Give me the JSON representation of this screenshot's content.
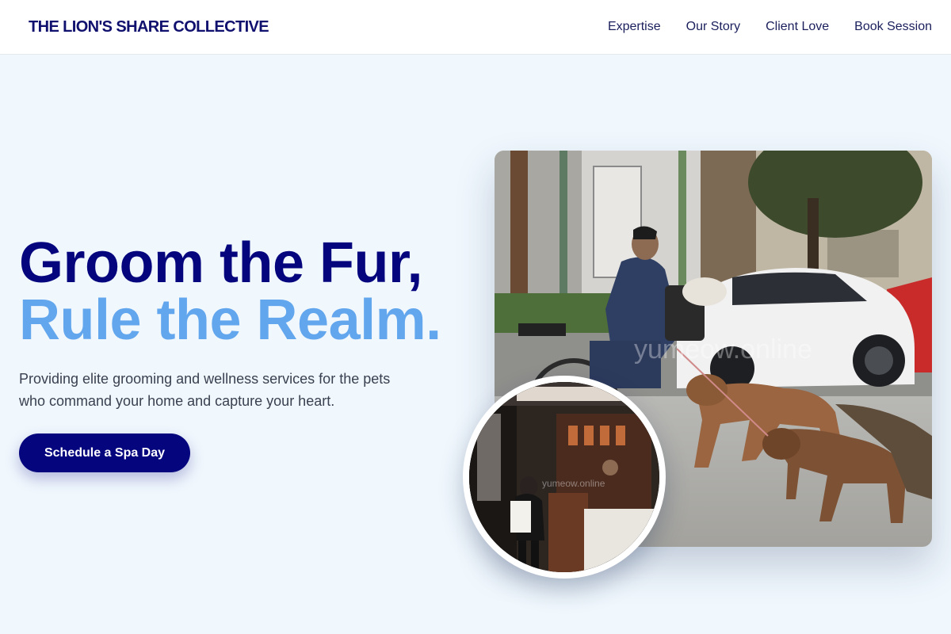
{
  "header": {
    "brand": "THE LION'S SHARE COLLECTIVE",
    "nav": [
      "Expertise",
      "Our Story",
      "Client Love",
      "Book Session"
    ]
  },
  "hero": {
    "title_line1": "Groom the Fur,",
    "title_line2": "Rule the Realm.",
    "subtitle": "Providing elite grooming and wellness services for the pets who command your home and capture your heart.",
    "cta_label": "Schedule a Spa Day"
  },
  "images": {
    "main_watermark": "yumeow.online",
    "inset_watermark": "yumeow.online"
  },
  "colors": {
    "primary": "#05057d",
    "accent": "#62a6ee",
    "background": "#f0f7fd"
  }
}
